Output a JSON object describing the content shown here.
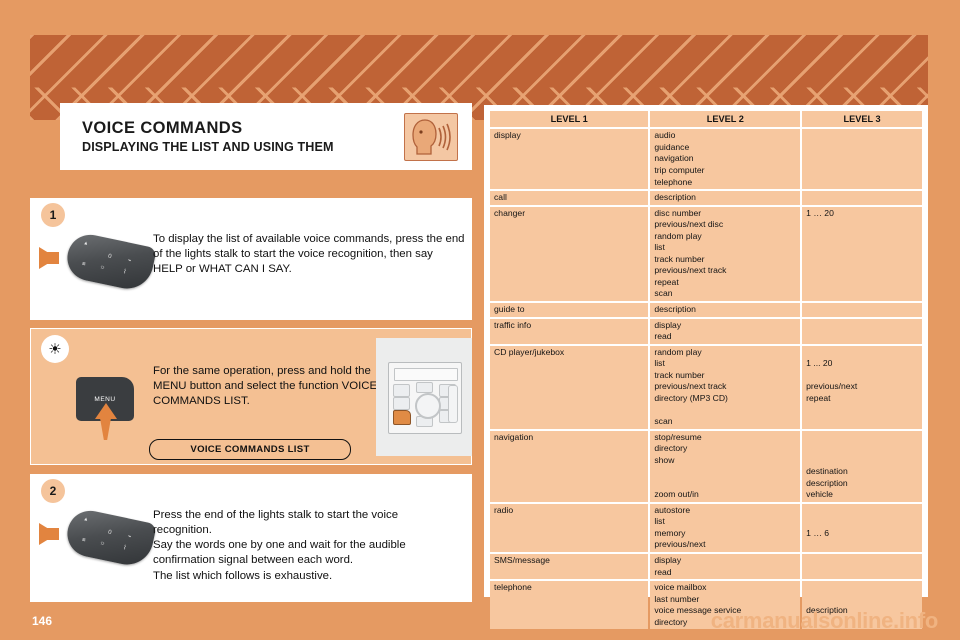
{
  "header": {
    "title": "VOICE COMMANDS",
    "subtitle": "DISPLAYING THE LIST AND USING THEM",
    "icon": "speaking-head-icon"
  },
  "steps": [
    {
      "badge": "1",
      "icon": "lights-stalk-illustration",
      "text": "To display the list of available voice commands, press the end of the lights stalk to start the voice recognition, then say HELP or WHAT CAN I SAY."
    },
    {
      "badge": "2",
      "icon": "lights-stalk-illustration",
      "text": "Press the end of the lights stalk to start the voice recognition.\nSay the words one by one and wait for the audible confirmation signal between each word.\nThe list which follows is exhaustive."
    }
  ],
  "tip": {
    "icon": "light-bulb-tip-icon",
    "text": "For the same operation, press and hold the MENU button and select the function VOICE COMMANDS LIST.",
    "menu_key_label": "MENU",
    "button_label": "VOICE COMMANDS LIST",
    "radio_menu_label": "MENU"
  },
  "table": {
    "headers": [
      "LEVEL 1",
      "LEVEL 2",
      "LEVEL 3"
    ],
    "rows": [
      {
        "level1": "display",
        "level2": "audio\nguidance\nnavigation\ntrip computer\ntelephone",
        "level3": ""
      },
      {
        "level1": "call",
        "level2": "description",
        "level3": ""
      },
      {
        "level1": "changer",
        "level2": "disc number\nprevious/next disc\nrandom play\nlist\ntrack number\nprevious/next track\nrepeat\nscan",
        "level3": "1 … 20"
      },
      {
        "level1": "guide to",
        "level2": "description",
        "level3": ""
      },
      {
        "level1": "traffic info",
        "level2": "display\nread",
        "level3": ""
      },
      {
        "level1": "CD player/jukebox",
        "level2": "random play\nlist\ntrack number\nprevious/next track\ndirectory (MP3 CD)\n\nscan",
        "level3": "\n1 ... 20\n\nprevious/next\nrepeat"
      },
      {
        "level1": "navigation",
        "level2": "stop/resume\ndirectory\nshow\n\n\nzoom out/in",
        "level3": "\n\n\ndestination\ndescription\nvehicle"
      },
      {
        "level1": "radio",
        "level2": "autostore\nlist\nmemory\nprevious/next",
        "level3": "\n\n1 … 6"
      },
      {
        "level1": "SMS/message",
        "level2": "display\nread",
        "level3": ""
      },
      {
        "level1": "telephone",
        "level2": "voice mailbox\nlast number\nvoice message service\ndirectory",
        "level3": "\n\ndescription"
      }
    ]
  },
  "footer": {
    "page_number": "146",
    "watermark": "carmanualsonline.info"
  },
  "colors": {
    "page_background": "#e59a62",
    "banner": "#bf6336",
    "panel_tint": "#f4c093",
    "table_cell": "#f7c79f",
    "accent_arrow": "#e2843f"
  }
}
